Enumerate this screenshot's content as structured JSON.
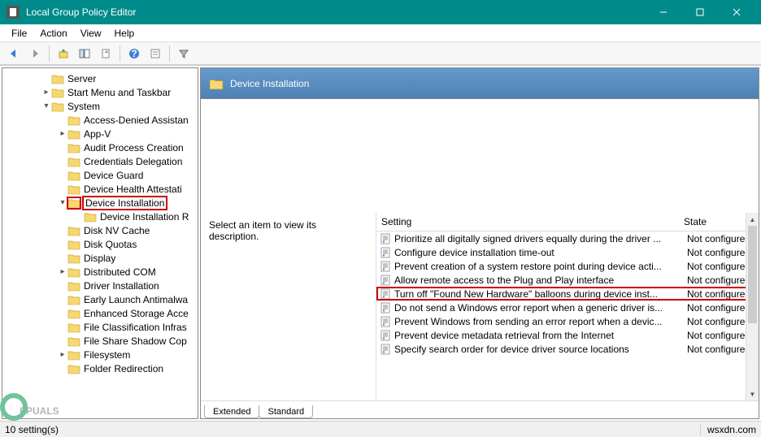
{
  "window": {
    "title": "Local Group Policy Editor"
  },
  "menu": {
    "file": "File",
    "action": "Action",
    "view": "View",
    "help": "Help"
  },
  "header": {
    "title": "Device Installation"
  },
  "desc": {
    "prompt": "Select an item to view its description."
  },
  "columns": {
    "setting": "Setting",
    "state": "State"
  },
  "tree": {
    "server": "Server",
    "startmenu": "Start Menu and Taskbar",
    "system": "System",
    "items": [
      "Access-Denied Assistan",
      "App-V",
      "Audit Process Creation",
      "Credentials Delegation",
      "Device Guard",
      "Device Health Attestati",
      "Device Installation",
      "Device Installation R",
      "Disk NV Cache",
      "Disk Quotas",
      "Display",
      "Distributed COM",
      "Driver Installation",
      "Early Launch Antimalwa",
      "Enhanced Storage Acce",
      "File Classification Infras",
      "File Share Shadow Cop",
      "Filesystem",
      "Folder Redirection"
    ]
  },
  "settings": [
    {
      "name": "Prioritize all digitally signed drivers equally during the driver ...",
      "state": "Not configured"
    },
    {
      "name": "Configure device installation time-out",
      "state": "Not configured"
    },
    {
      "name": "Prevent creation of a system restore point during device acti...",
      "state": "Not configured"
    },
    {
      "name": "Allow remote access to the Plug and Play interface",
      "state": "Not configured"
    },
    {
      "name": "Turn off \"Found New Hardware\" balloons during device inst...",
      "state": "Not configured",
      "highlight": true
    },
    {
      "name": "Do not send a Windows error report when a generic driver is...",
      "state": "Not configured"
    },
    {
      "name": "Prevent Windows from sending an error report when a devic...",
      "state": "Not configured"
    },
    {
      "name": "Prevent device metadata retrieval from the Internet",
      "state": "Not configured"
    },
    {
      "name": "Specify search order for device driver source locations",
      "state": "Not configured"
    }
  ],
  "tabs": {
    "extended": "Extended",
    "standard": "Standard"
  },
  "status": {
    "count": "10 setting(s)",
    "site": "wsxdn.com"
  },
  "watermark": {
    "text": "PPUALS"
  }
}
